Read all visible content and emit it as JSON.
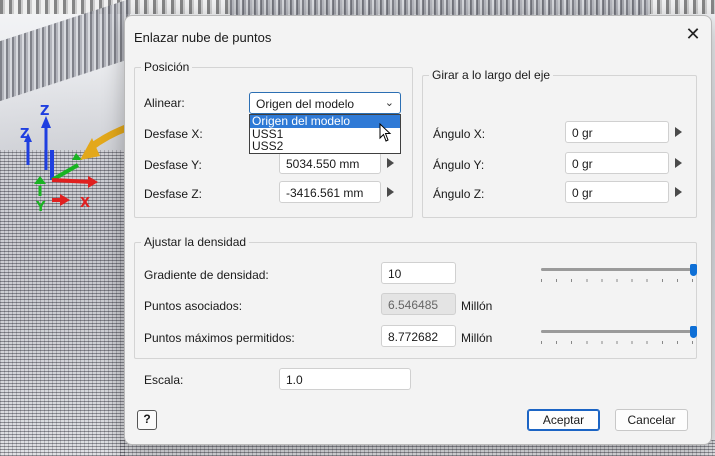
{
  "dialog": {
    "title": "Enlazar nube de puntos",
    "close_glyph": "✕"
  },
  "position_group": {
    "title": "Posición",
    "align_label": "Alinear:",
    "align_selected": "Origen del modelo",
    "align_options": [
      "Origen del modelo",
      "USS1",
      "USS2"
    ],
    "offset_x_label": "Desfase X:",
    "offset_y_label": "Desfase Y:",
    "offset_y_value": "5034.550 mm",
    "offset_z_label": "Desfase Z:",
    "offset_z_value": "-3416.561 mm"
  },
  "rotate_group": {
    "title": "Girar a lo largo del eje",
    "angle_x_label": "Ángulo X:",
    "angle_x_value": "0 gr",
    "angle_y_label": "Ángulo Y:",
    "angle_y_value": "0 gr",
    "angle_z_label": "Ángulo Z:",
    "angle_z_value": "0 gr"
  },
  "density_group": {
    "title": "Ajustar la densidad",
    "gradient_label": "Gradiente de densidad:",
    "gradient_value": "10",
    "gradient_slider_fraction": 1.0,
    "associated_label": "Puntos asociados:",
    "associated_value": "6.546485",
    "associated_unit": "Millón",
    "max_label": "Puntos máximos permitidos:",
    "max_value": "8.772682",
    "max_unit": "Millón",
    "max_slider_fraction": 1.0
  },
  "scale": {
    "label": "Escala:",
    "value": "1.0"
  },
  "buttons": {
    "help": "?",
    "accept": "Aceptar",
    "cancel": "Cancelar"
  },
  "gizmo": {
    "z": "Z",
    "y": "Y",
    "x": "X"
  },
  "colors": {
    "accent": "#1b64c4",
    "selection": "#2f7ad6",
    "slider_thumb": "#0e6fd6",
    "callout_arrow": "#e3a81b",
    "axis_x": "#e02020",
    "axis_y": "#19b422",
    "axis_z": "#1f3fe0"
  }
}
